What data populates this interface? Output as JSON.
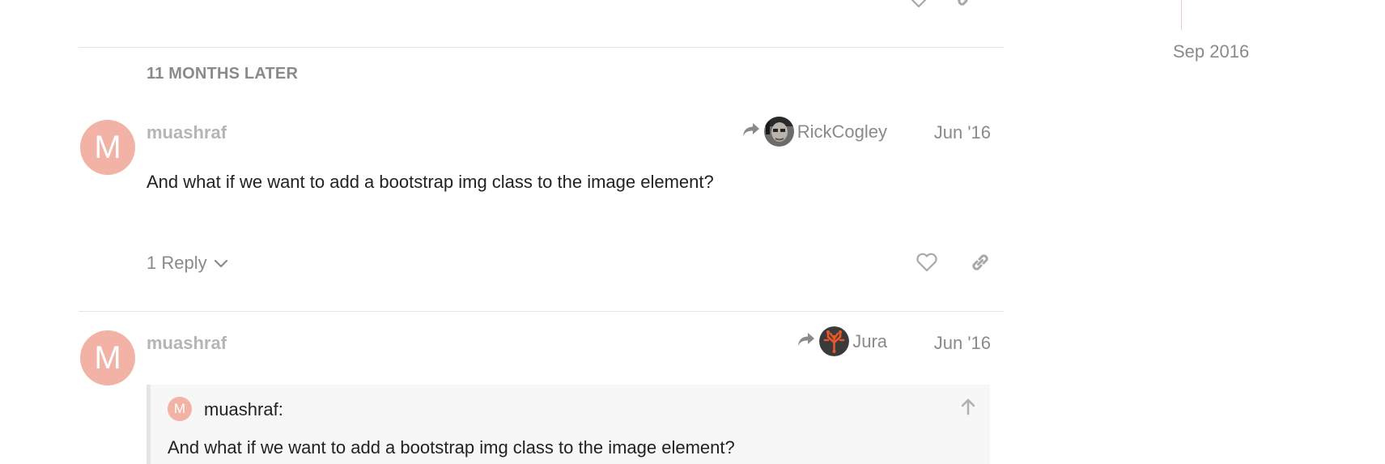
{
  "timeline": {
    "date_label": "Sep 2016"
  },
  "time_gap": {
    "label": "11 MONTHS LATER"
  },
  "posts": [
    {
      "avatar_letter": "M",
      "username": "muashraf",
      "reply_to_user": "RickCogley",
      "date": "Jun '16",
      "body": "And what if we want to add a bootstrap img class to the image element?",
      "replies_label": "1 Reply"
    },
    {
      "avatar_letter": "M",
      "username": "muashraf",
      "reply_to_user": "Jura",
      "date": "Jun '16",
      "quote": {
        "avatar_letter": "M",
        "user": "muashraf:",
        "text": "And what if we want to add a bootstrap img class to the image element?"
      }
    }
  ],
  "colors": {
    "avatar_bg": "#f2b2a5",
    "muted_text": "#8a8a8a",
    "divider": "#e5e5e5",
    "jura_avatar_bg": "#3a3a3a",
    "jura_avatar_accent": "#e8562a"
  },
  "icons": {
    "like": "heart-icon",
    "share": "link-icon",
    "reply_arrow": "share-arrow-icon",
    "expand": "chevron-down-icon",
    "jump": "arrow-up-icon"
  }
}
